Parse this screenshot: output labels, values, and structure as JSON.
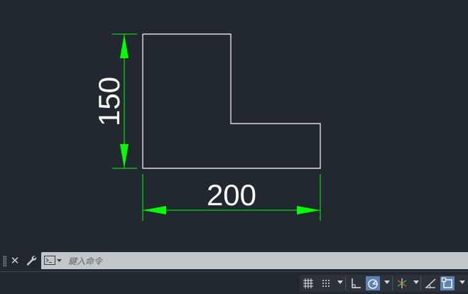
{
  "drawing": {
    "dimensions": [
      {
        "name": "vertical",
        "value": "150"
      },
      {
        "name": "horizontal",
        "value": "200"
      }
    ],
    "colors": {
      "background": "#212830",
      "geometry": "#ffffff",
      "dimension_lines": "#00ff00"
    }
  },
  "command_line": {
    "placeholder": "鍵入命令",
    "icons": [
      "grip-handle-icon",
      "close-icon",
      "wrench-icon",
      "command-prompt-icon",
      "chevron-down-icon"
    ]
  },
  "status_bar": {
    "buttons": [
      {
        "name": "grid-display",
        "icon": "grid-icon",
        "active": false
      },
      {
        "name": "snap-mode",
        "icon": "snap-dots-icon",
        "active": false
      },
      {
        "name": "ortho-mode",
        "icon": "ortho-icon",
        "active": false
      },
      {
        "name": "polar-tracking",
        "icon": "polar-icon",
        "active": true
      },
      {
        "name": "isodraft",
        "icon": "isodraft-icon",
        "active": false
      },
      {
        "name": "object-snap-tracking",
        "icon": "angle-icon",
        "active": false
      },
      {
        "name": "object-snap",
        "icon": "osnap-square-icon",
        "active": true
      }
    ]
  }
}
